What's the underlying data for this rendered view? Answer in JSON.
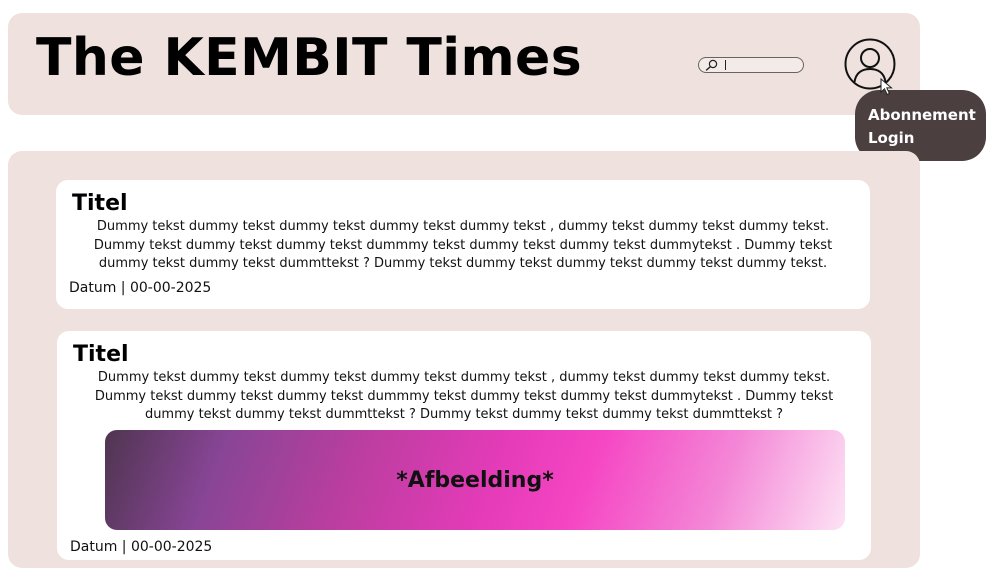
{
  "header": {
    "title": "The KEMBIT Times",
    "search": {
      "value": "",
      "placeholder": ""
    },
    "avatar_icon": "user-circle-icon",
    "search_icon": "magnifier-icon"
  },
  "account_menu": {
    "items": [
      {
        "label": "Abonnement"
      },
      {
        "label": "Login"
      }
    ],
    "pointer_icon": "mouse-pointer-icon"
  },
  "articles": [
    {
      "title": "Titel",
      "body": "Dummy tekst dummy tekst dummy tekst dummy tekst dummy tekst , dummy tekst dummy tekst dummy tekst. Dummy tekst dummy tekst dummy tekst dummmy tekst dummy tekst dummy tekst dummytekst . Dummy tekst dummy tekst dummy tekst dummttekst ? Dummy tekst dummy tekst dummy tekst dummy tekst dummy tekst.",
      "date": "Datum | 00-00-2025"
    },
    {
      "title": "Titel",
      "body": "Dummy tekst dummy tekst dummy tekst dummy tekst dummy tekst , dummy tekst dummy tekst dummy tekst. Dummy tekst dummy tekst dummy tekst dummmy tekst dummy tekst dummy tekst dummytekst . Dummy tekst dummy tekst dummy tekst dummttekst ? Dummy tekst dummy tekst dummy tekst dummttekst ?",
      "image_label": "*Afbeelding*",
      "date": "Datum | 00-00-2025"
    }
  ],
  "colors": {
    "panel_background": "#efe2de",
    "card_background": "#ffffff",
    "menu_background": "#4b3f3f",
    "text": "#000000"
  }
}
